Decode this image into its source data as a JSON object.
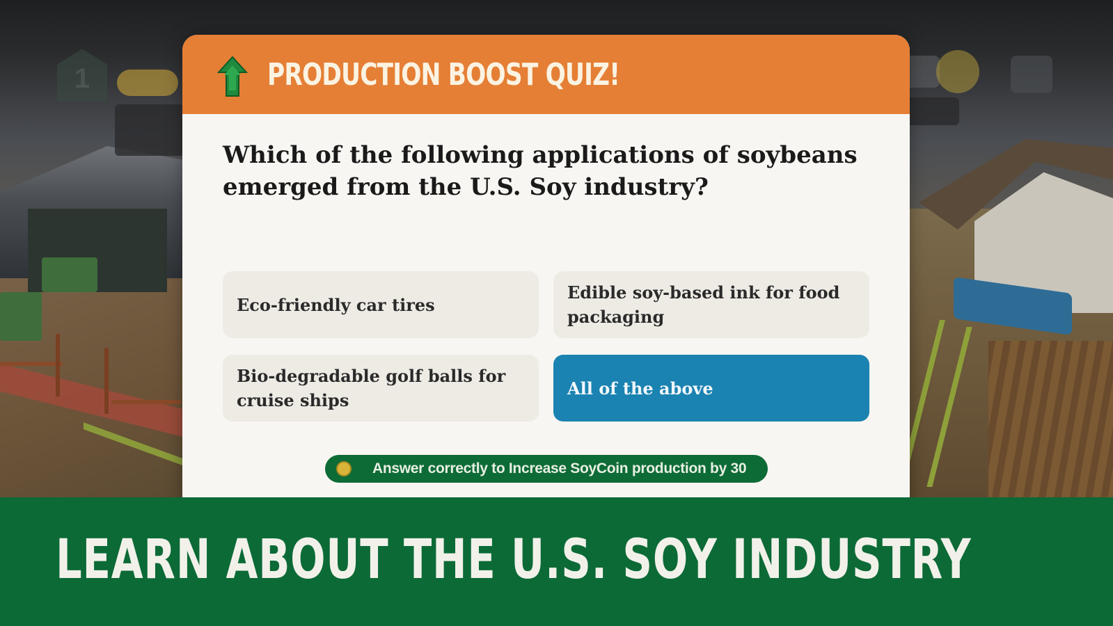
{
  "hud": {
    "level": "1"
  },
  "quiz": {
    "title": "PRODUCTION BOOST QUIZ!",
    "header_icon": "green-up-arrow-icon",
    "question": "Which of the following applications of soybeans emerged from the U.S. Soy industry?",
    "answers": [
      {
        "label": "Eco-friendly car tires",
        "selected": false
      },
      {
        "label": "Edible soy-based ink for food packaging",
        "selected": false
      },
      {
        "label": "Bio-degradable golf balls for cruise ships",
        "selected": false
      },
      {
        "label": "All of the above",
        "selected": true
      }
    ],
    "boost_icon": "soycoin-icon",
    "boost_text": "Answer correctly to Increase SoyCoin production by 30"
  },
  "banner": {
    "text": "LEARN ABOUT THE U.S. SOY INDUSTRY"
  },
  "colors": {
    "header_orange": "#e57f35",
    "selected_blue": "#1b83b1",
    "brand_green": "#0c6a36"
  }
}
